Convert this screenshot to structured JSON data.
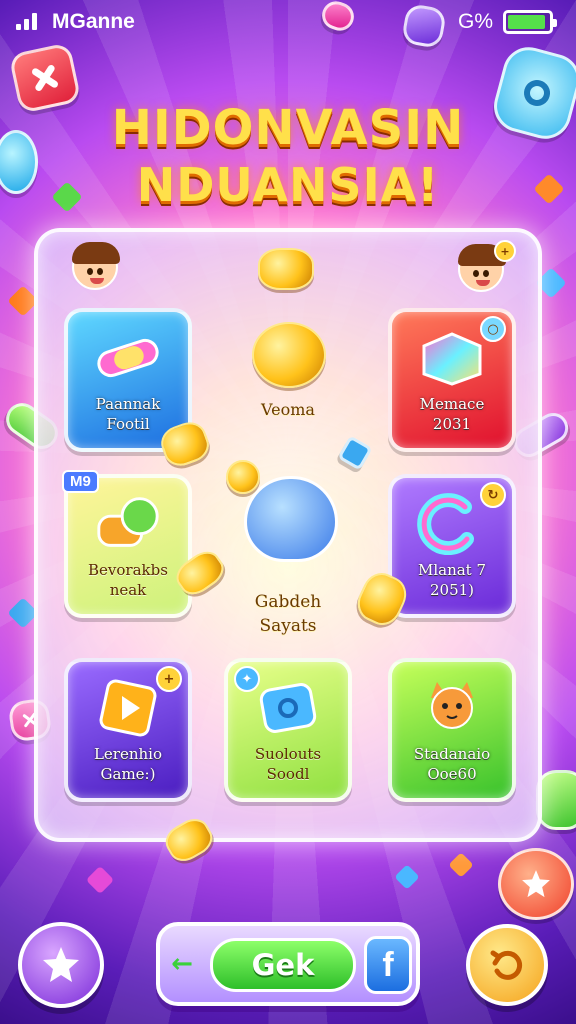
{
  "status_bar": {
    "app_name": "MGanne",
    "battery_text": "G%",
    "battery_level": 0.85
  },
  "title": {
    "line1": "HIDONVASIN",
    "line2": "NDUANSIA!"
  },
  "board": {
    "badge": "M9",
    "center_top_label": "Veoma",
    "center_label_line1": "Gabdeh",
    "center_label_line2": "Sayats",
    "tiles": [
      {
        "line1": "Paannak",
        "line2": "Footil"
      },
      {
        "line1": "Memace",
        "line2": "2031"
      },
      {
        "line1": "Bevorakbs",
        "line2": "neak"
      },
      {
        "line1": "Mlanat 7",
        "line2": "2051)"
      },
      {
        "line1": "Lerenhio",
        "line2": "Game:)"
      },
      {
        "line1": "Suolouts",
        "line2": "Soodl"
      },
      {
        "line1": "Stadanaio",
        "line2": "Ooe60"
      }
    ]
  },
  "bottom_bar": {
    "go_label": "Gek",
    "share_label": "f",
    "back_label": "←"
  },
  "icons": {
    "close": "close-icon",
    "star": "star-icon",
    "play": "play-icon",
    "undo": "undo-icon"
  },
  "colors": {
    "title": "#ffe04a",
    "go_button": "#2ebf2a",
    "share_button": "#1c6ee0"
  }
}
